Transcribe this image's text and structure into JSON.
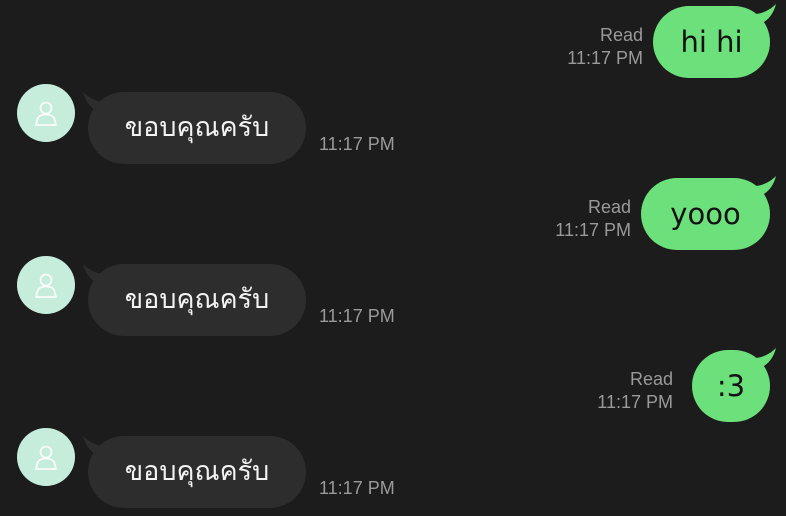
{
  "messages": [
    {
      "direction": "outgoing",
      "text": "hi hi",
      "status": "Read",
      "time": "11:17 PM"
    },
    {
      "direction": "incoming",
      "text": "ขอบคุณครับ",
      "time": "11:17 PM"
    },
    {
      "direction": "outgoing",
      "text": "yooo",
      "status": "Read",
      "time": "11:17 PM"
    },
    {
      "direction": "incoming",
      "text": "ขอบคุณครับ",
      "time": "11:17 PM"
    },
    {
      "direction": "outgoing",
      "text": ":3",
      "status": "Read",
      "time": "11:17 PM"
    },
    {
      "direction": "incoming",
      "text": "ขอบคุณครับ",
      "time": "11:17 PM"
    }
  ],
  "colors": {
    "background": "#1c1c1c",
    "outgoing_bubble": "#6ce07a",
    "incoming_bubble": "#2d2d2d",
    "avatar_bg": "#c6ecdc",
    "meta_text": "#9a9a9a"
  },
  "icons": {
    "avatar": "person-outline-icon"
  }
}
